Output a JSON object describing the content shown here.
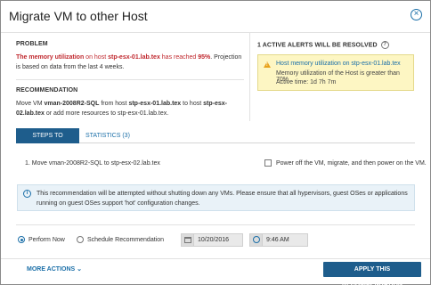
{
  "dialog": {
    "title": "Migrate VM to other Host",
    "close_glyph": "×"
  },
  "problem": {
    "heading": "PROBLEM",
    "metric": "The memory utilization",
    "on_host": " on host ",
    "host": "stp-esx-01.lab.tex",
    "reached": " has reached ",
    "pct": "95%",
    "rest": ". Projection is based on data from the last 4 weeks."
  },
  "recommendation": {
    "heading": "RECOMMENDATION",
    "p1": "Move VM ",
    "vm": "vman-2008R2-SQL",
    "p2": " from host ",
    "from_host": "stp-esx-01.lab.tex",
    "p3": " to host ",
    "to_host": "stp-esx-02.lab.tex",
    "p4": " or add more resources to stp-esx-01.lab.tex."
  },
  "alerts": {
    "heading": "1 ACTIVE ALERTS WILL BE RESOLVED",
    "help_glyph": "?",
    "warn_glyph": "!",
    "alert_title": "Host memory utilization on stp-esx-01.lab.tex",
    "alert_desc": "Memory utilization of the Host is greater than 70%",
    "active_time": "Active time: 1d 7h 7m"
  },
  "tabs": [
    {
      "label": "STEPS TO PERFORM",
      "active": true
    },
    {
      "label": "STATISTICS (3)",
      "active": false
    }
  ],
  "steps": {
    "step1": "1.  Move vman-2008R2-SQL to stp-esx-02.lab.tex",
    "checkbox_label": "Power off the VM, migrate, and then power on the VM.",
    "checked": false
  },
  "info": {
    "icon_glyph": "i",
    "text": "This recommendation will be attempted without shutting down any VMs. Please ensure that all hypervisors, guest OSes or applications running on guest OSes support 'hot' configuration changes."
  },
  "schedule": {
    "perform_now": "Perform Now",
    "schedule_label": "Schedule Recommendation",
    "selected": "perform_now",
    "date": "10/20/2016",
    "time": "9:46 AM"
  },
  "footer": {
    "more_actions": "MORE ACTIONS ⌄",
    "apply": "APPLY THIS RECOMMENDATION"
  },
  "colors": {
    "accent": "#1e5d8c",
    "link": "#1b6fa8",
    "danger": "#c0282e",
    "alert_bg": "#fdf6c3"
  }
}
